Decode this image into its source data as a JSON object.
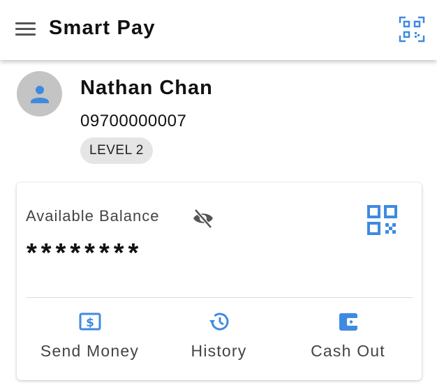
{
  "app": {
    "title": "Smart Pay",
    "accent_color": "#3f8ae0",
    "icons": {
      "menu": "hamburger-menu-icon",
      "scan": "qr-scan-icon"
    }
  },
  "profile": {
    "name": "Nathan Chan",
    "phone": "09700000007",
    "level": "LEVEL 2",
    "avatar_icon": "person-icon"
  },
  "balance": {
    "label": "Available Balance",
    "value": "********",
    "visibility_icon": "eye-off-icon",
    "qr_icon": "qr-code-icon"
  },
  "actions": [
    {
      "label": "Send Money",
      "icon": "dollar-note-icon"
    },
    {
      "label": "History",
      "icon": "history-icon"
    },
    {
      "label": "Cash Out",
      "icon": "wallet-icon"
    }
  ]
}
